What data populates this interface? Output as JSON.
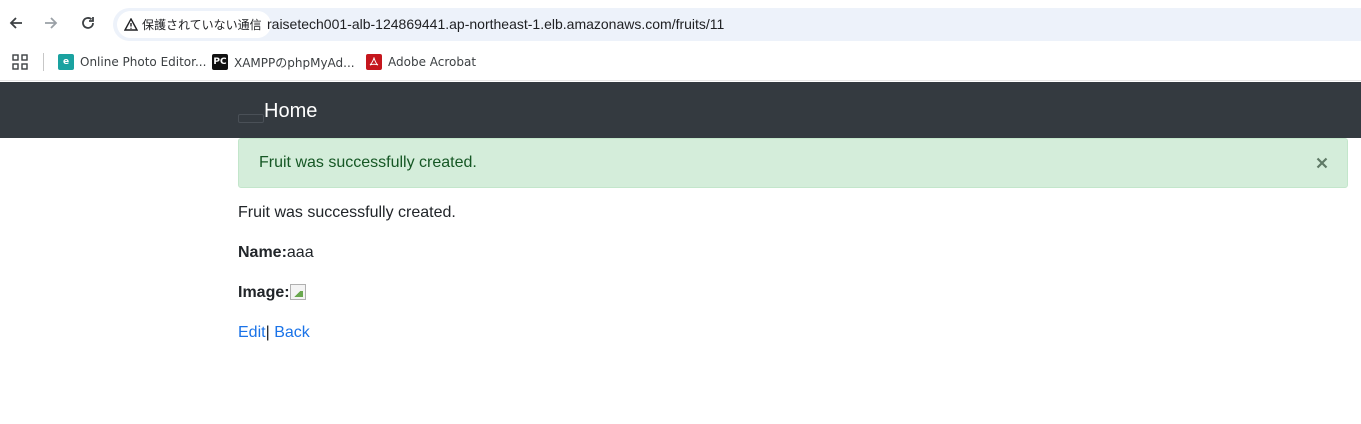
{
  "browser": {
    "security_label": "保護されていない通信",
    "url": "raisetech001-alb-124869441.ap-northeast-1.elb.amazonaws.com/fruits/11",
    "bookmarks": [
      {
        "label": "Online Photo Editor...",
        "icon": "photo-editor-icon",
        "color": "#1aa2a0"
      },
      {
        "label": "XAMPPのphpMyAd...",
        "icon": "pc-icon",
        "color": "#111111"
      },
      {
        "label": "Adobe Acrobat",
        "icon": "acrobat-icon",
        "color": "#c5161d"
      }
    ]
  },
  "navbar": {
    "brand": "Home"
  },
  "alert": {
    "message": "Fruit was successfully created.",
    "close_label": "×"
  },
  "fruit": {
    "notice": "Fruit was successfully created.",
    "name_label": "Name:",
    "name_value": "aaa",
    "image_label": "Image:"
  },
  "actions": {
    "edit_label": "Edit",
    "separator": "|",
    "back_label": "Back"
  }
}
